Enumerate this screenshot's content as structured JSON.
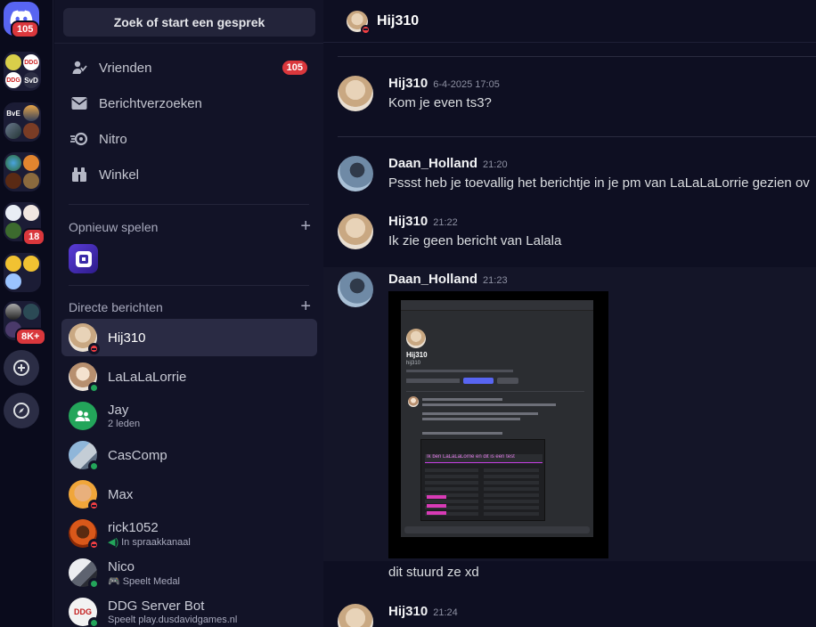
{
  "rail": {
    "home_badge": "105",
    "folders": [
      {
        "labels": [
          "",
          "DDG",
          "DDG",
          "SvD"
        ]
      },
      {
        "labels": [
          "BvE",
          "",
          "",
          ""
        ]
      },
      {
        "labels": [
          "",
          "",
          "",
          ""
        ]
      },
      {
        "labels": [
          "",
          "",
          "",
          ""
        ],
        "badge": "18"
      },
      {
        "labels": [
          "",
          "",
          "",
          ""
        ]
      },
      {
        "labels": [
          "",
          "",
          "",
          ""
        ],
        "badge": "8K+"
      }
    ],
    "add_server_icon": "plus-icon",
    "discover_icon": "compass-icon"
  },
  "sidebar": {
    "search_label": "Zoek of start een gesprek",
    "nav": [
      {
        "label": "Vrienden",
        "icon": "friends-icon",
        "badge": "105"
      },
      {
        "label": "Berichtverzoeken",
        "icon": "envelope-icon"
      },
      {
        "label": "Nitro",
        "icon": "nitro-icon"
      },
      {
        "label": "Winkel",
        "icon": "shop-icon"
      }
    ],
    "play_again_header": "Opnieuw spelen",
    "dm_header": "Directe berichten",
    "dms": [
      {
        "name": "Hij310",
        "sub": "",
        "status": "dnd"
      },
      {
        "name": "LaLaLaLorrie",
        "sub": "",
        "status": "online"
      },
      {
        "name": "Jay",
        "sub": "2 leden",
        "status": ""
      },
      {
        "name": "CasComp",
        "sub": "",
        "status": "online"
      },
      {
        "name": "Max",
        "sub": "",
        "status": "dnd"
      },
      {
        "name": "rick1052",
        "sub": "In spraakkanaal",
        "status": "dnd"
      },
      {
        "name": "Nico",
        "sub": "Speelt Medal",
        "status": "online"
      },
      {
        "name": "DDG Server Bot",
        "sub": "Speelt play.dusdavidgames.nl",
        "status": "online"
      }
    ],
    "ddg_avatar_label": "DDG"
  },
  "chat": {
    "title": "Hij310",
    "messages": [
      {
        "author": "Hij310",
        "time": "6-4-2025 17:05",
        "text": "Kom je even ts3?"
      },
      {
        "author": "Daan_Holland",
        "time": "21:20",
        "text": "Pssst heb je  toevallig het berichtje in je pm van LaLaLaLorrie gezien ov"
      },
      {
        "author": "Hij310",
        "time": "21:22",
        "text": "Ik zie geen bericht van Lalala"
      },
      {
        "author": "Daan_Holland",
        "time": "21:23",
        "text": ""
      },
      {
        "text": "dit stuurd ze xd"
      },
      {
        "author": "Hij310",
        "time": "21:24",
        "text": ""
      }
    ],
    "embedded_shot": {
      "name": "Hij310",
      "tag": "hij310",
      "highlight_text": "Ik ben LaLaLaLorrie en dit is een test"
    }
  }
}
